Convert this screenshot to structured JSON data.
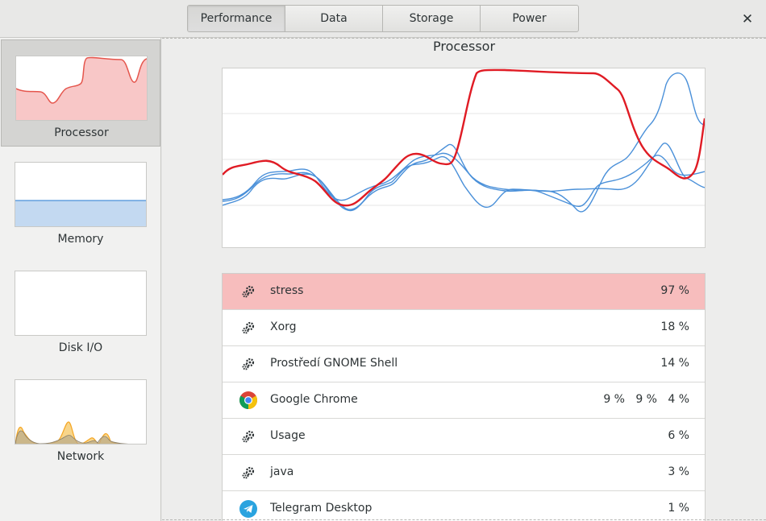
{
  "header": {
    "tabs": [
      {
        "label": "Performance",
        "active": true
      },
      {
        "label": "Data",
        "active": false
      },
      {
        "label": "Storage",
        "active": false
      },
      {
        "label": "Power",
        "active": false
      }
    ],
    "close_icon": "close-icon"
  },
  "sidebar": {
    "items": [
      {
        "label": "Processor",
        "active": true
      },
      {
        "label": "Memory",
        "active": false
      },
      {
        "label": "Disk I/O",
        "active": false
      },
      {
        "label": "Network",
        "active": false
      }
    ],
    "colors": {
      "processor": "#e01b24",
      "memory": "#4a90d9",
      "network": "#f5a623"
    }
  },
  "main": {
    "title": "Processor",
    "chart_colors": {
      "total": "#e01b24",
      "cores": "#4a90d9"
    },
    "processes": [
      {
        "icon": "gears-icon",
        "name": "stress",
        "value": "97 %",
        "highlight": true
      },
      {
        "icon": "gears-icon",
        "name": "Xorg",
        "value": "18 %",
        "highlight": false
      },
      {
        "icon": "gears-icon",
        "name": "Prostředí GNOME Shell",
        "value": "14 %",
        "highlight": false
      },
      {
        "icon": "chrome-icon",
        "name": "Google Chrome",
        "value": "9 %   9 %   4 %",
        "highlight": false
      },
      {
        "icon": "gears-icon",
        "name": "Usage",
        "value": "6 %",
        "highlight": false
      },
      {
        "icon": "gears-icon",
        "name": "java",
        "value": "3 %",
        "highlight": false
      },
      {
        "icon": "telegram-icon",
        "name": "Telegram Desktop",
        "value": "1 %",
        "highlight": false
      }
    ]
  }
}
